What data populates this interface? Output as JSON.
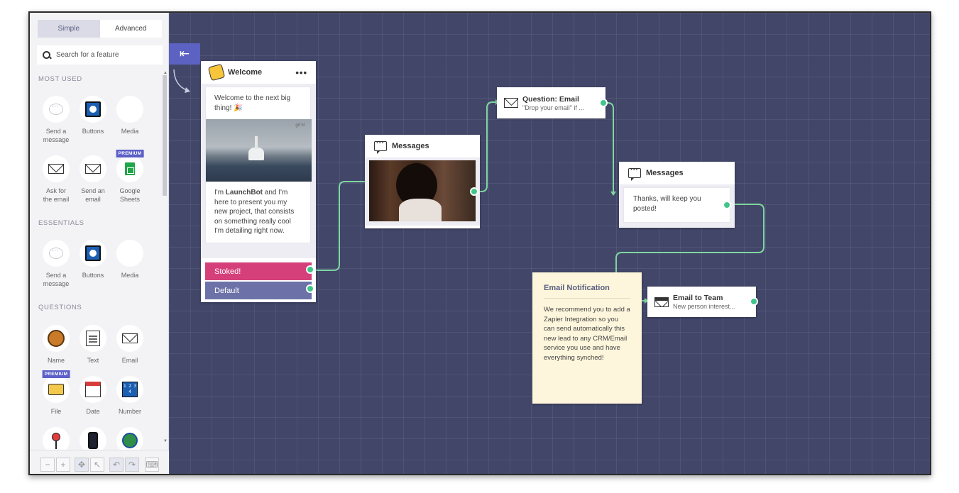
{
  "sidebar": {
    "tabs": [
      {
        "label": "Simple",
        "active": true
      },
      {
        "label": "Advanced",
        "active": false
      }
    ],
    "search_placeholder": "Search for a feature",
    "sections": [
      {
        "title": "MOST USED",
        "items": [
          {
            "label1": "Send a",
            "label2": "message",
            "icon": "message-bubble-icon"
          },
          {
            "label1": "Buttons",
            "label2": "",
            "icon": "buttons-icon"
          },
          {
            "label1": "Media",
            "label2": "",
            "icon": "media-icon"
          },
          {
            "label1": "Ask for",
            "label2": "the email",
            "icon": "envelope-icon"
          },
          {
            "label1": "Send an",
            "label2": "email",
            "icon": "send-email-icon"
          },
          {
            "label1": "Google",
            "label2": "Sheets",
            "icon": "google-sheets-icon",
            "badge": "PREMIUM"
          }
        ]
      },
      {
        "title": "ESSENTIALS",
        "items": [
          {
            "label1": "Send a",
            "label2": "message",
            "icon": "message-bubble-icon"
          },
          {
            "label1": "Buttons",
            "label2": "",
            "icon": "buttons-icon"
          },
          {
            "label1": "Media",
            "label2": "",
            "icon": "media-icon"
          }
        ]
      },
      {
        "title": "QUESTIONS",
        "items": [
          {
            "label1": "Name",
            "icon": "face-icon"
          },
          {
            "label1": "Text",
            "icon": "notepad-icon"
          },
          {
            "label1": "Email",
            "icon": "envelope-icon"
          },
          {
            "label1": "File",
            "icon": "folder-icon",
            "badge": "PREMIUM"
          },
          {
            "label1": "Date",
            "icon": "calendar-icon"
          },
          {
            "label1": "Number",
            "icon": "number-icon",
            "digits": "1 2 3 4"
          },
          {
            "icon": "pin-icon"
          },
          {
            "icon": "phone-icon"
          },
          {
            "icon": "globe-icon"
          }
        ]
      }
    ],
    "toolbar": {
      "zoom_out": "−",
      "zoom_in": "+"
    }
  },
  "canvas": {
    "welcome": {
      "title": "Welcome",
      "menu": "•••",
      "intro": "Welcome to the next big thing! 🎉",
      "gif_badge": "gif hl",
      "text_before": "I'm ",
      "text_bold": "LaunchBot",
      "text_after": " and I'm here to present you my new project, that consists on something really cool I'm detailing right now.",
      "choices": [
        {
          "label": "Stoked!",
          "color": "#d6407a"
        },
        {
          "label": "Default",
          "color": "#6c72a8"
        }
      ]
    },
    "messages1": {
      "title": "Messages"
    },
    "question_email": {
      "title": "Question: Email",
      "subtitle": "\"Drop your email\" if ..."
    },
    "messages2": {
      "title": "Messages",
      "text": "Thanks, will keep you posted!"
    },
    "note": {
      "title": "Email Notification",
      "text": "We recommend you to add a Zapier Integration so you can send automatically this new lead to any CRM/Email service you use and have everything synched!"
    },
    "email_team": {
      "title": "Email to Team",
      "subtitle": "New person interest..."
    }
  },
  "colors": {
    "canvas": "#424669",
    "accent": "#5b62c2",
    "port": "#42c58a",
    "link": "#7fd6a0"
  }
}
